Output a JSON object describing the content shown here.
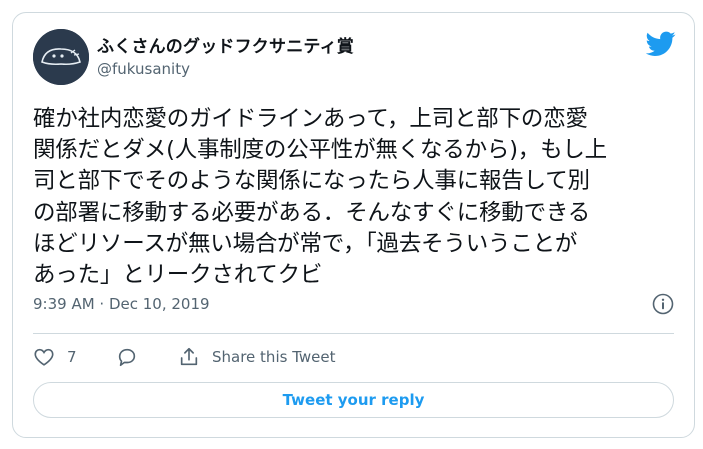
{
  "tweet": {
    "author_name": "ふくさんのグッドフクサニティ賞",
    "author_handle": "@fukusanity",
    "text": "確か社内恋愛のガイドラインあって，上司と部下の恋愛\n関係だとダメ(人事制度の公平性が無くなるから)，もし上\n司と部下でそのような関係になったら人事に報告して別\nの部署に移動する必要がある．そんなすぐに移動できる\nほどリソースが無い場合が常で，「過去そういうことが\nあった」とリークされてクビ",
    "timestamp": "9:39 AM · Dec 10, 2019",
    "like_count": "7",
    "share_label": "Share this Tweet",
    "reply_label": "Tweet your reply"
  },
  "colors": {
    "accent": "#1d9bf0",
    "secondary_text": "#536471",
    "border": "#cfd9de",
    "avatar_bg": "#2b3a4d"
  },
  "icons": {
    "brand": "twitter-bird-icon",
    "info": "info-icon",
    "like": "heart-icon",
    "reply": "comment-icon",
    "share": "share-icon"
  }
}
